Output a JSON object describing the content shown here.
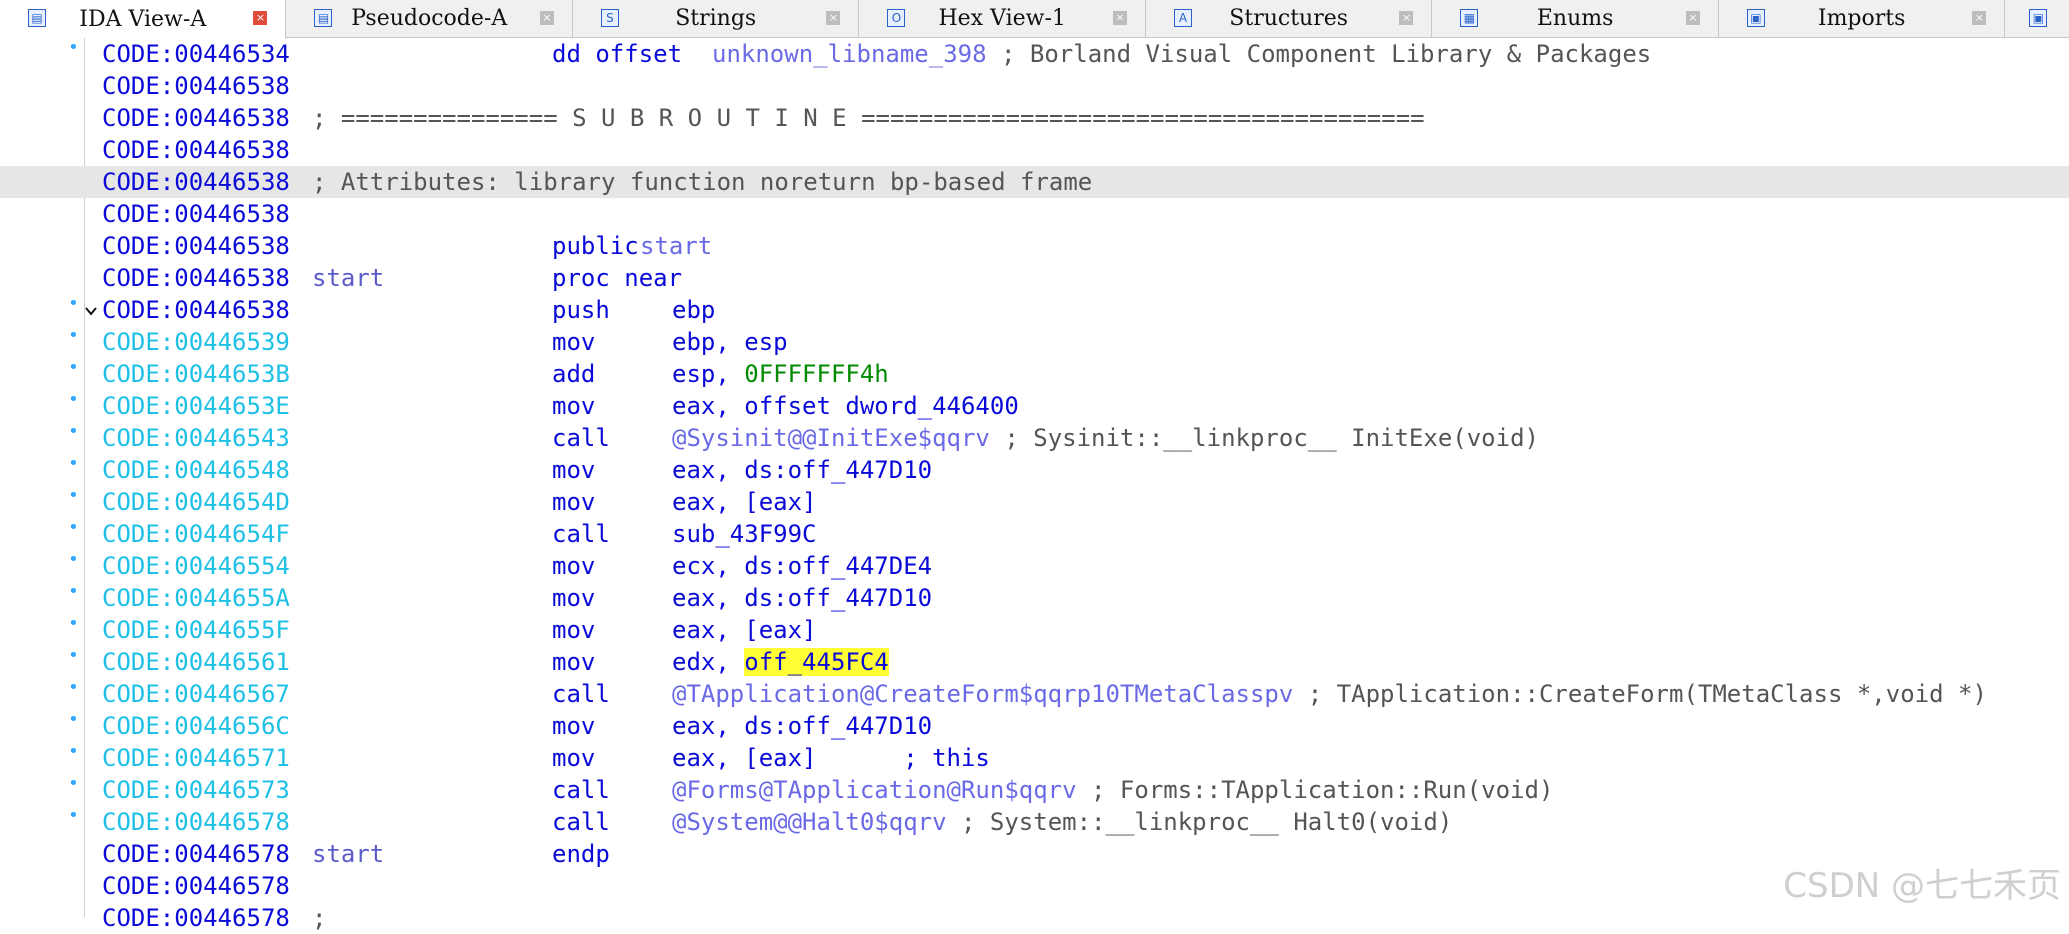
{
  "tabs": [
    {
      "label": "IDA View-A",
      "icon": "ida-view-icon",
      "glyph": "▤",
      "active": true
    },
    {
      "label": "Pseudocode-A",
      "icon": "pseudocode-icon",
      "glyph": "▤",
      "active": false
    },
    {
      "label": "Strings",
      "icon": "strings-icon",
      "glyph": "S",
      "active": false
    },
    {
      "label": "Hex View-1",
      "icon": "hex-view-icon",
      "glyph": "O",
      "active": false
    },
    {
      "label": "Structures",
      "icon": "structures-icon",
      "glyph": "A",
      "active": false
    },
    {
      "label": "Enums",
      "icon": "enums-icon",
      "glyph": "▦",
      "active": false
    },
    {
      "label": "Imports",
      "icon": "imports-icon",
      "glyph": "▣",
      "active": false
    }
  ],
  "tab_close_glyph": "×",
  "listing": {
    "lines": [
      {
        "addr": "CODE:00446534",
        "color": "code",
        "dot": true,
        "mnem": "dd offset",
        "ops": [
          {
            "t": "unknown_libname_398",
            "c": "name"
          },
          {
            "t": " ; Borland Visual Component Library & Packages",
            "c": "cmt"
          }
        ]
      },
      {
        "addr": "CODE:00446538",
        "color": "code"
      },
      {
        "addr": "CODE:00446538",
        "color": "code",
        "full": "; =============== S U B R O U T I N E ======================================="
      },
      {
        "addr": "CODE:00446538",
        "color": "code"
      },
      {
        "addr": "CODE:00446538",
        "color": "code",
        "hl": true,
        "full": "; Attributes: library function noreturn bp-based frame"
      },
      {
        "addr": "CODE:00446538",
        "color": "code"
      },
      {
        "addr": "CODE:00446538",
        "color": "code",
        "mnem": "public",
        "ops": [
          {
            "t": "start",
            "c": "name",
            "gap": true
          }
        ]
      },
      {
        "addr": "CODE:00446538",
        "color": "code",
        "label": "start",
        "mnem": "proc near"
      },
      {
        "addr": "CODE:00446538",
        "color": "code",
        "dot": true,
        "fold": true,
        "mnem": "push",
        "ops": [
          {
            "t": "ebp",
            "c": "op"
          }
        ]
      },
      {
        "addr": "CODE:00446539",
        "color": "cyan",
        "dot": true,
        "mnem": "mov",
        "ops": [
          {
            "t": "ebp, esp",
            "c": "op"
          }
        ]
      },
      {
        "addr": "CODE:0044653B",
        "color": "cyan",
        "dot": true,
        "mnem": "add",
        "ops": [
          {
            "t": "esp, ",
            "c": "op"
          },
          {
            "t": "0FFFFFFF4h",
            "c": "num"
          }
        ]
      },
      {
        "addr": "CODE:0044653E",
        "color": "cyan",
        "dot": true,
        "mnem": "mov",
        "ops": [
          {
            "t": "eax, offset dword_446400",
            "c": "op"
          }
        ]
      },
      {
        "addr": "CODE:00446543",
        "color": "cyan",
        "dot": true,
        "mnem": "call",
        "ops": [
          {
            "t": "@Sysinit@@InitExe$qqrv",
            "c": "sym"
          },
          {
            "t": " ; Sysinit::__linkproc__ InitExe(void)",
            "c": "cmt"
          }
        ]
      },
      {
        "addr": "CODE:00446548",
        "color": "cyan",
        "dot": true,
        "mnem": "mov",
        "ops": [
          {
            "t": "eax, ds:off_447D10",
            "c": "op"
          }
        ]
      },
      {
        "addr": "CODE:0044654D",
        "color": "cyan",
        "dot": true,
        "mnem": "mov",
        "ops": [
          {
            "t": "eax, [eax]",
            "c": "op"
          }
        ]
      },
      {
        "addr": "CODE:0044654F",
        "color": "cyan",
        "dot": true,
        "mnem": "call",
        "ops": [
          {
            "t": "sub_43F99C",
            "c": "op"
          }
        ]
      },
      {
        "addr": "CODE:00446554",
        "color": "cyan",
        "dot": true,
        "mnem": "mov",
        "ops": [
          {
            "t": "ecx, ds:off_447DE4",
            "c": "op"
          }
        ]
      },
      {
        "addr": "CODE:0044655A",
        "color": "cyan",
        "dot": true,
        "mnem": "mov",
        "ops": [
          {
            "t": "eax, ds:off_447D10",
            "c": "op"
          }
        ]
      },
      {
        "addr": "CODE:0044655F",
        "color": "cyan",
        "dot": true,
        "mnem": "mov",
        "ops": [
          {
            "t": "eax, [eax]",
            "c": "op"
          }
        ]
      },
      {
        "addr": "CODE:00446561",
        "color": "cyan",
        "dot": true,
        "mnem": "mov",
        "ops": [
          {
            "t": "edx, ",
            "c": "op"
          },
          {
            "t": "off_445FC4",
            "c": "hl"
          }
        ]
      },
      {
        "addr": "CODE:00446567",
        "color": "cyan",
        "dot": true,
        "mnem": "call",
        "ops": [
          {
            "t": "@TApplication@CreateForm$qqrp10TMetaClasspv",
            "c": "sym"
          },
          {
            "t": " ; TApplication::CreateForm(TMetaClass *,void *)",
            "c": "cmt"
          }
        ]
      },
      {
        "addr": "CODE:0044656C",
        "color": "cyan",
        "dot": true,
        "mnem": "mov",
        "ops": [
          {
            "t": "eax, ds:off_447D10",
            "c": "op"
          }
        ]
      },
      {
        "addr": "CODE:00446571",
        "color": "cyan",
        "dot": true,
        "mnem": "mov",
        "ops": [
          {
            "t": "eax, [eax]      ; this",
            "c": "op"
          }
        ]
      },
      {
        "addr": "CODE:00446573",
        "color": "cyan",
        "dot": true,
        "mnem": "call",
        "ops": [
          {
            "t": "@Forms@TApplication@Run$qqrv",
            "c": "sym"
          },
          {
            "t": " ; Forms::TApplication::Run(void)",
            "c": "cmt"
          }
        ]
      },
      {
        "addr": "CODE:00446578",
        "color": "cyan",
        "dot": true,
        "mnem": "call",
        "ops": [
          {
            "t": "@System@@Halt0$qqrv",
            "c": "sym"
          },
          {
            "t": " ; System::__linkproc__ Halt0(void)",
            "c": "cmt"
          }
        ]
      },
      {
        "addr": "CODE:00446578",
        "color": "code",
        "label": "start",
        "mnem": "endp"
      },
      {
        "addr": "CODE:00446578",
        "color": "code"
      },
      {
        "addr": "CODE:00446578",
        "color": "code",
        "full": ";"
      }
    ]
  },
  "watermark": "CSDN @七七禾页",
  "colors": {
    "code": "#0a0ad8",
    "cyan": "#1ec0e6",
    "name": "#6a6ae6",
    "num": "#008a00",
    "comment": "#555555",
    "highlight": "#ffff33"
  }
}
